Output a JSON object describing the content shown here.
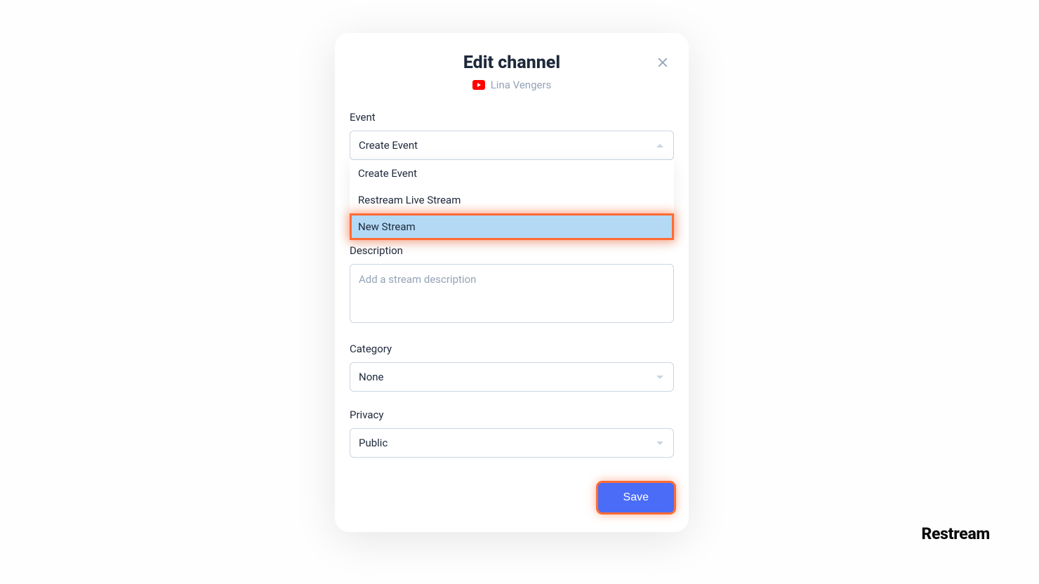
{
  "modal": {
    "title": "Edit channel",
    "channel_name": "Lina Vengers"
  },
  "form": {
    "event": {
      "label": "Event",
      "value": "Create Event",
      "options": [
        "Create Event",
        "Restream Live Stream",
        "New Stream"
      ]
    },
    "description": {
      "label": "Description",
      "placeholder": "Add a stream description"
    },
    "category": {
      "label": "Category",
      "value": "None"
    },
    "privacy": {
      "label": "Privacy",
      "value": "Public"
    }
  },
  "buttons": {
    "save": "Save"
  },
  "brand": "Restream"
}
